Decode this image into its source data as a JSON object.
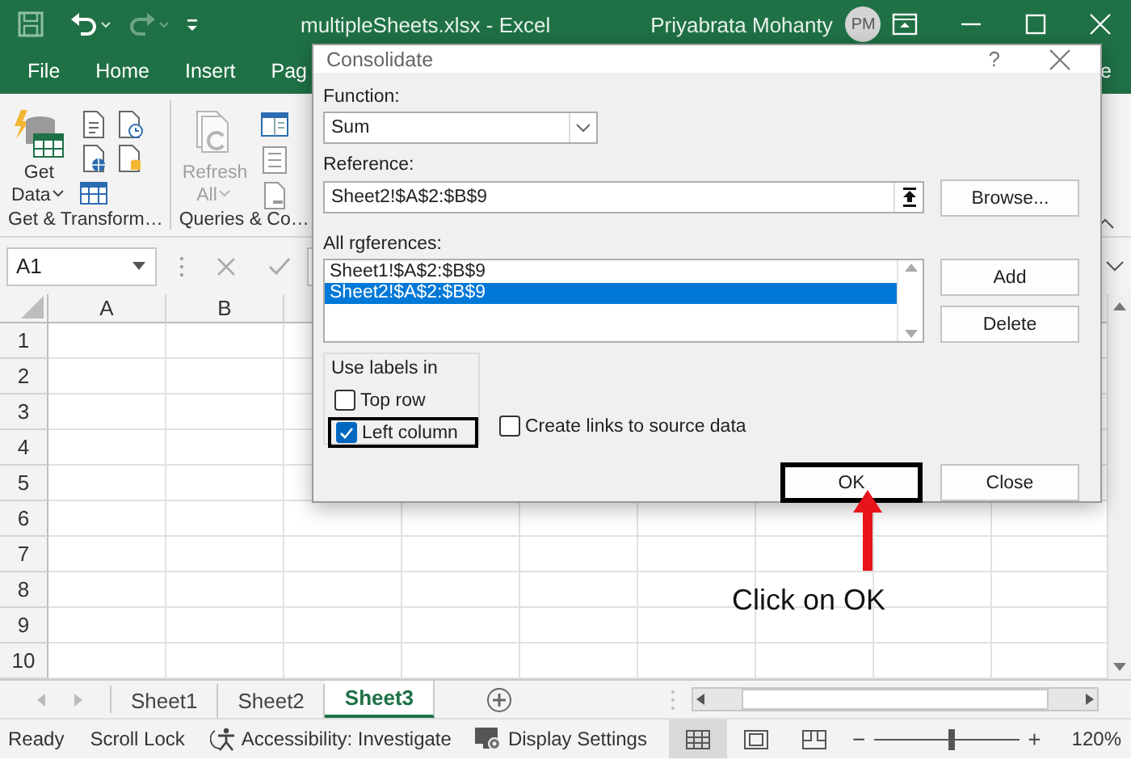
{
  "title_bar": {
    "title": "multipleSheets.xlsx  -  Excel",
    "user": "Priyabrata Mohanty",
    "avatar": "PM"
  },
  "ribbon_tabs": [
    "File",
    "Home",
    "Insert",
    "Pag",
    "e"
  ],
  "ribbon_groups": [
    {
      "label": "Get & Transform…",
      "button": {
        "lines": [
          "Get",
          "Data"
        ],
        "disabled": false
      }
    },
    {
      "label": "Queries & Co…",
      "button": {
        "lines": [
          "Refresh",
          "All"
        ],
        "disabled": true
      }
    }
  ],
  "formula_bar": {
    "name_box": "A1"
  },
  "grid": {
    "columns": [
      "A",
      "B"
    ],
    "rows": [
      "1",
      "2",
      "3",
      "4",
      "5",
      "6",
      "7",
      "8",
      "9",
      "10"
    ]
  },
  "sheet_tabs": [
    {
      "label": "Sheet1",
      "selected": false
    },
    {
      "label": "Sheet2",
      "selected": false
    },
    {
      "label": "Sheet3",
      "selected": true
    }
  ],
  "status_bar": {
    "items": [
      {
        "kind": "text",
        "label": "Ready"
      },
      {
        "kind": "text",
        "label": "Scroll Lock"
      },
      {
        "kind": "accessibility",
        "label": "Accessibility: Investigate"
      },
      {
        "kind": "display",
        "label": "Display Settings"
      }
    ],
    "views": [
      {
        "kind": "normal",
        "selected": true
      },
      {
        "kind": "page-layout",
        "selected": false
      },
      {
        "kind": "page-break",
        "selected": false
      }
    ],
    "zoom": {
      "minus": "−",
      "plus": "+",
      "level": 0.53,
      "reading": "120%"
    }
  },
  "dialog": {
    "title": "Consolidate",
    "help": "?",
    "function_label": "Function:",
    "function": "Sum",
    "reference_label": "Reference:",
    "reference": "Sheet2!$A$2:$B$9",
    "all_references_label": "All rgferences:",
    "references": [
      {
        "text": "Sheet1!$A$2:$B$9",
        "selected": false
      },
      {
        "text": "Sheet2!$A$2:$B$9",
        "selected": true
      }
    ],
    "use_labels_label": "Use labels in",
    "checkboxes": [
      {
        "label": "Top row",
        "checked": false,
        "highlighted": false
      },
      {
        "label": "Left column",
        "checked": true,
        "highlighted": true
      },
      {
        "label": "Create links to source data",
        "checked": false,
        "highlighted": false
      }
    ],
    "buttons": [
      {
        "kind": "browse",
        "label": "Browse...",
        "highlighted": false
      },
      {
        "kind": "add",
        "label": "Add",
        "highlighted": false
      },
      {
        "kind": "delete",
        "label": "Delete",
        "highlighted": false
      },
      {
        "kind": "ok",
        "label": "OK",
        "highlighted": true
      },
      {
        "kind": "close",
        "label": "Close",
        "highlighted": false
      }
    ]
  },
  "annotation": {
    "text": "Click on OK"
  }
}
